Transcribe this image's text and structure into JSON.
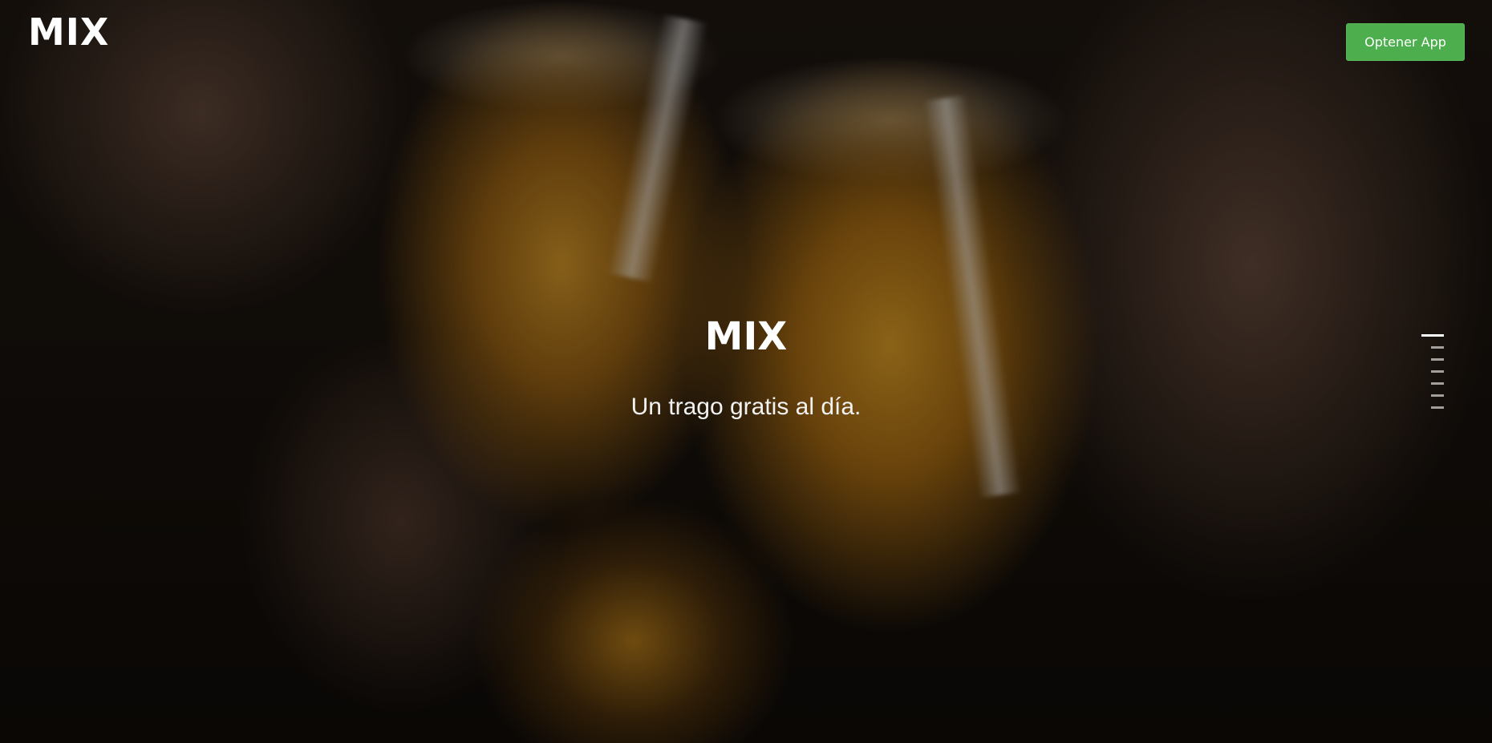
{
  "header": {
    "brand": "MIX",
    "cta_label": "Optener App"
  },
  "hero": {
    "title": "MIX",
    "subtitle": "Un trago gratis al día.",
    "background_image": "beer-mugs-toast",
    "overlay_color": "#000000"
  },
  "section_nav": {
    "count": 7,
    "active_index": 0
  },
  "colors": {
    "cta_background": "#4cae4c",
    "text": "#ffffff"
  }
}
